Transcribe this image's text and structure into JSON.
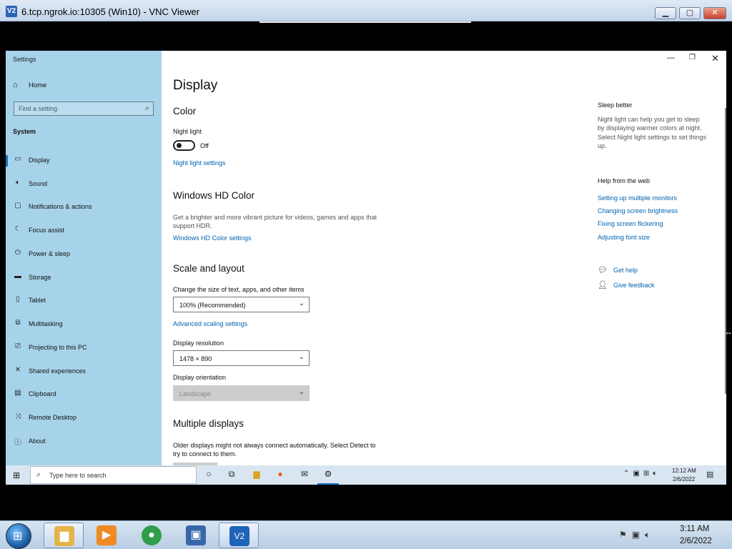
{
  "vnc": {
    "title": "6.tcp.ngrok.io:10305 (Win10) - VNC Viewer",
    "logo": "V2",
    "min": "▁",
    "max": "▢",
    "close": "✕"
  },
  "settings": {
    "app_title": "Settings",
    "controls": {
      "min": "—",
      "max": "❐",
      "close": "✕"
    },
    "sidebar": {
      "home": "Home",
      "search_placeholder": "Find a setting",
      "section": "System",
      "items": [
        {
          "label": "Display",
          "icon": "monitor-icon"
        },
        {
          "label": "Sound",
          "icon": "speaker-icon"
        },
        {
          "label": "Notifications & actions",
          "icon": "notification-icon"
        },
        {
          "label": "Focus assist",
          "icon": "moon-icon"
        },
        {
          "label": "Power & sleep",
          "icon": "power-icon"
        },
        {
          "label": "Storage",
          "icon": "storage-icon"
        },
        {
          "label": "Tablet",
          "icon": "tablet-icon"
        },
        {
          "label": "Multitasking",
          "icon": "multitasking-icon"
        },
        {
          "label": "Projecting to this PC",
          "icon": "projecting-icon"
        },
        {
          "label": "Shared experiences",
          "icon": "shared-icon"
        },
        {
          "label": "Clipboard",
          "icon": "clipboard-icon"
        },
        {
          "label": "Remote Desktop",
          "icon": "remote-desktop-icon"
        },
        {
          "label": "About",
          "icon": "info-icon"
        }
      ]
    },
    "main": {
      "title": "Display",
      "color": {
        "heading": "Color",
        "night_light_label": "Night light",
        "night_light_state": "Off",
        "night_light_link": "Night light settings"
      },
      "hd": {
        "heading": "Windows HD Color",
        "desc_line1": "Get a brighter and more vibrant picture for videos, games and apps that",
        "desc_line2": "support HDR.",
        "link": "Windows HD Color settings"
      },
      "scale": {
        "heading": "Scale and layout",
        "size_label": "Change the size of text, apps, and other items",
        "size_value": "100% (Recommended)",
        "advanced_link": "Advanced scaling settings",
        "resolution_label": "Display resolution",
        "resolution_value": "1478 × 890",
        "orientation_label": "Display orientation",
        "orientation_value": "Landscape"
      },
      "multiple": {
        "heading": "Multiple displays",
        "desc_line1": "Older displays might not always connect automatically. Select Detect to",
        "desc_line2": "try to connect to them."
      }
    },
    "right": {
      "sleep_heading": "Sleep better",
      "sleep_lines": [
        "Night light can help you get to sleep",
        "by displaying warmer colors at night.",
        "Select Night light settings to set things",
        "up."
      ],
      "web_heading": "Help from the web",
      "web_links": [
        "Setting up multiple monitors",
        "Changing screen brightness",
        "Fixing screen flickering",
        "Adjusting font size"
      ],
      "get_help": "Get help",
      "give_feedback": "Give feedback"
    }
  },
  "taskbar10": {
    "search_placeholder": "Type here to search",
    "time": "12:12 AM",
    "date": "2/6/2022",
    "notify_count": "12"
  },
  "taskbar7": {
    "time": "3:11 AM",
    "date": "2/6/2022"
  },
  "colors": {
    "sidebar_bg": "#a7d3ea",
    "accent": "#0063b1",
    "taskbar10_bg": "#d9e6f2"
  }
}
